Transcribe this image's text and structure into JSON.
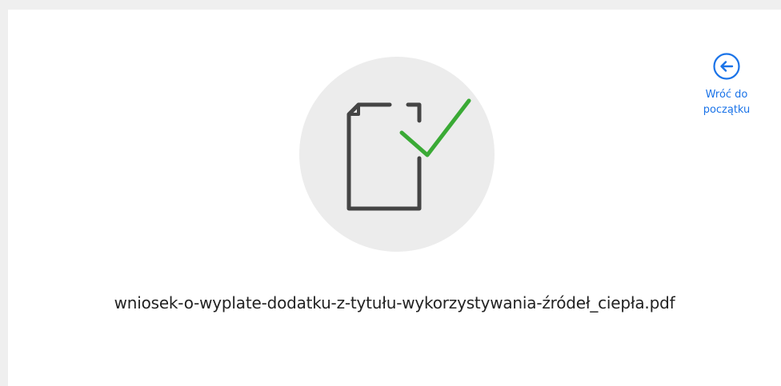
{
  "back": {
    "label": "Wróć do\npoczątku",
    "icon": "arrow-left-circle-icon"
  },
  "file": {
    "name": "wniosek-o-wyplate-dodatku-z-tytułu-wykorzystywania-źródeł_ciepła.pdf",
    "icon": "document-check-icon"
  },
  "colors": {
    "accent": "#1a73e8",
    "check": "#3aaa35",
    "document_stroke": "#444444",
    "circle_bg": "#ececec"
  }
}
